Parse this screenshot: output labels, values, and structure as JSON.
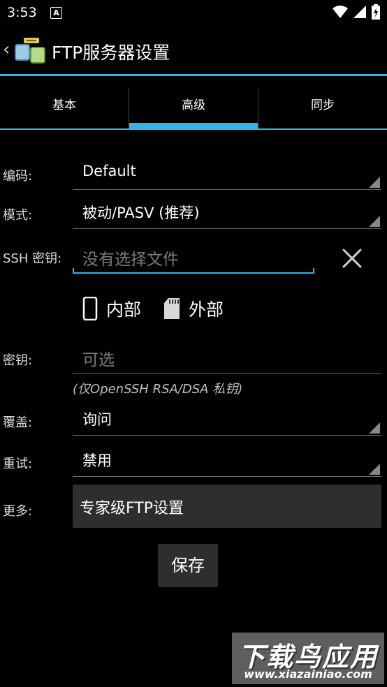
{
  "status_bar": {
    "time": "3:53",
    "notification_glyph": "A"
  },
  "action_bar": {
    "title": "FTP服务器设置"
  },
  "tabs": [
    {
      "label": "基本",
      "active": false
    },
    {
      "label": "高级",
      "active": true
    },
    {
      "label": "同步",
      "active": false
    }
  ],
  "fields": {
    "encoding": {
      "label": "编码:",
      "value": "Default"
    },
    "mode": {
      "label": "模式:",
      "value": "被动/PASV (推荐)"
    },
    "ssh_key": {
      "label": "SSH 密钥:",
      "placeholder": "没有选择文件"
    },
    "storage": {
      "internal": "内部",
      "external": "外部"
    },
    "passphrase": {
      "label": "密钥:",
      "placeholder": "可选",
      "hint": "(仅OpenSSH RSA/DSA 私钥)"
    },
    "overwrite": {
      "label": "覆盖:",
      "value": "询问"
    },
    "retry": {
      "label": "重试:",
      "value": "禁用"
    },
    "more": {
      "label": "更多:",
      "button": "专家级FTP设置"
    }
  },
  "save_button": "保存",
  "watermark": {
    "big": "下载鸟应用",
    "small": "www.xiazainiao.com"
  },
  "colors": {
    "accent": "#33b5e5",
    "background": "#000000",
    "button": "#2e2e2e"
  }
}
